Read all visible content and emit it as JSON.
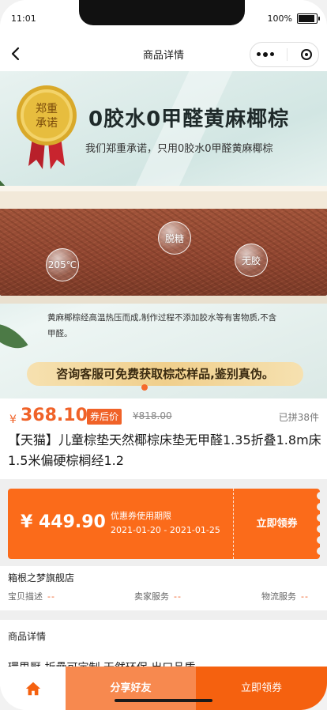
{
  "status": {
    "time": "11:01",
    "battery": "100%",
    "battery_level": 1.0
  },
  "nav": {
    "title": "商品详情",
    "back_icon": "chevron-left-icon",
    "more_icon": "more-dots-icon",
    "close_icon": "target-circle-icon"
  },
  "banner": {
    "medal_text": [
      "郑重",
      "承诺"
    ],
    "headline": "0胶水0甲醛黄麻椰棕",
    "subline": "我们郑重承诺，只用0胶水0甲醛黄麻椰棕",
    "bubbles": [
      "205℃",
      "脱糖",
      "无胶"
    ],
    "description": "黄麻椰棕经高温热压而成,制作过程不添加胶水等有害物质,不含甲醛。",
    "cta": "咨询客服可免费获取棕芯样品,鉴别真伪。"
  },
  "price": {
    "currency": "¥",
    "current": "368.10",
    "tag": "券后价",
    "original": "¥818.00",
    "sold": "已拼38件"
  },
  "product_title": "【天猫】儿童棕垫天然椰棕床垫无甲醛1.35折叠1.8m床1.5米偏硬棕榈经1.2",
  "coupon": {
    "amount": "¥ 449.90",
    "rule": "优惠券使用期限",
    "date_range": "2021-01-20 - 2021-01-25",
    "button": "立即领券"
  },
  "shop": {
    "name": "箱根之梦旗舰店",
    "ratings": [
      {
        "label": "宝贝描述",
        "value": "--"
      },
      {
        "label": "卖家服务",
        "value": "--"
      },
      {
        "label": "物流服务",
        "value": "--"
      }
    ]
  },
  "detail": {
    "title": "商品详情",
    "text_preview": "環思壓 折疊可定制 天然环保 出口品质"
  },
  "bottom": {
    "home_icon": "home-icon",
    "share": "分享好友",
    "claim": "立即领券"
  },
  "colors": {
    "accent": "#f06228",
    "coupon_bg": "#fb6b1a",
    "share_bg": "#f7894f",
    "claim_bg": "#f5610f"
  }
}
